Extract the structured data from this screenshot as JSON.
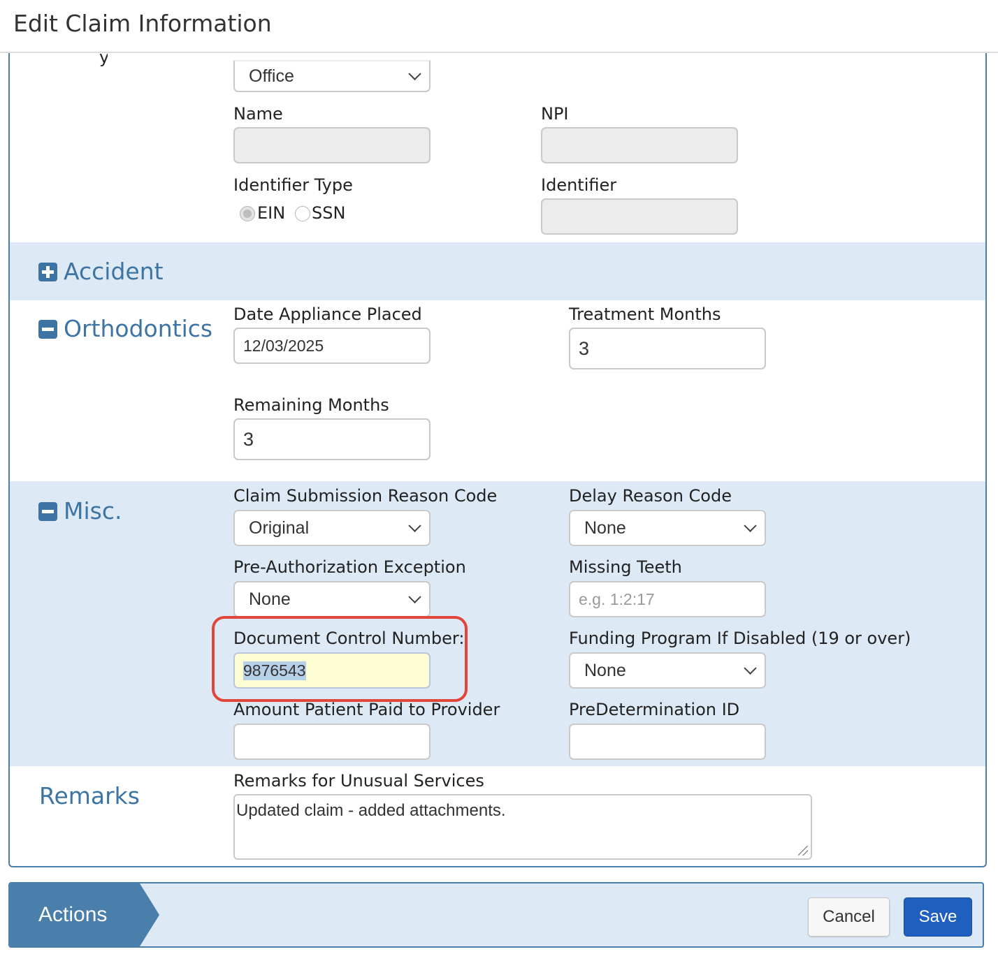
{
  "header": {
    "title": "Edit Claim Information"
  },
  "provider": {
    "type_select": "Office",
    "name_label": "Name",
    "name_value": "",
    "npi_label": "NPI",
    "npi_value": "",
    "identifier_type_label": "Identifier Type",
    "identifier_type_options": [
      "EIN",
      "SSN"
    ],
    "identifier_type_selected": "EIN",
    "identifier_label": "Identifier",
    "identifier_value": ""
  },
  "accident": {
    "title": "Accident",
    "icon": "plus-box-icon"
  },
  "orthodontics": {
    "title": "Orthodontics",
    "icon": "minus-box-icon",
    "date_label": "Date Appliance Placed",
    "date_value": "12/03/2025",
    "treatment_label": "Treatment Months",
    "treatment_value": "3",
    "remaining_label": "Remaining Months",
    "remaining_value": "3"
  },
  "misc": {
    "title": "Misc.",
    "icon": "minus-box-icon",
    "submission_reason_label": "Claim Submission Reason Code",
    "submission_reason_value": "Original",
    "delay_reason_label": "Delay Reason Code",
    "delay_reason_value": "None",
    "preauth_label": "Pre-Authorization Exception",
    "preauth_value": "None",
    "missing_teeth_label": "Missing Teeth",
    "missing_teeth_placeholder": "e.g. 1:2:17",
    "dcn_label": "Document Control Number:",
    "dcn_value": "9876543",
    "funding_label": "Funding Program If Disabled (19 or over)",
    "funding_value": "None",
    "amount_paid_label": "Amount Patient Paid to Provider",
    "amount_paid_value": "",
    "predetermination_label": "PreDetermination ID",
    "predetermination_value": ""
  },
  "remarks": {
    "title": "Remarks",
    "label": "Remarks for Unusual Services",
    "value": "Updated claim - added attachments."
  },
  "actions": {
    "title": "Actions",
    "cancel_label": "Cancel",
    "save_label": "Save"
  },
  "colors": {
    "accent": "#3e74a3",
    "band": "#dde9f4",
    "callout": "#e0463a",
    "save": "#1f5fc0"
  }
}
